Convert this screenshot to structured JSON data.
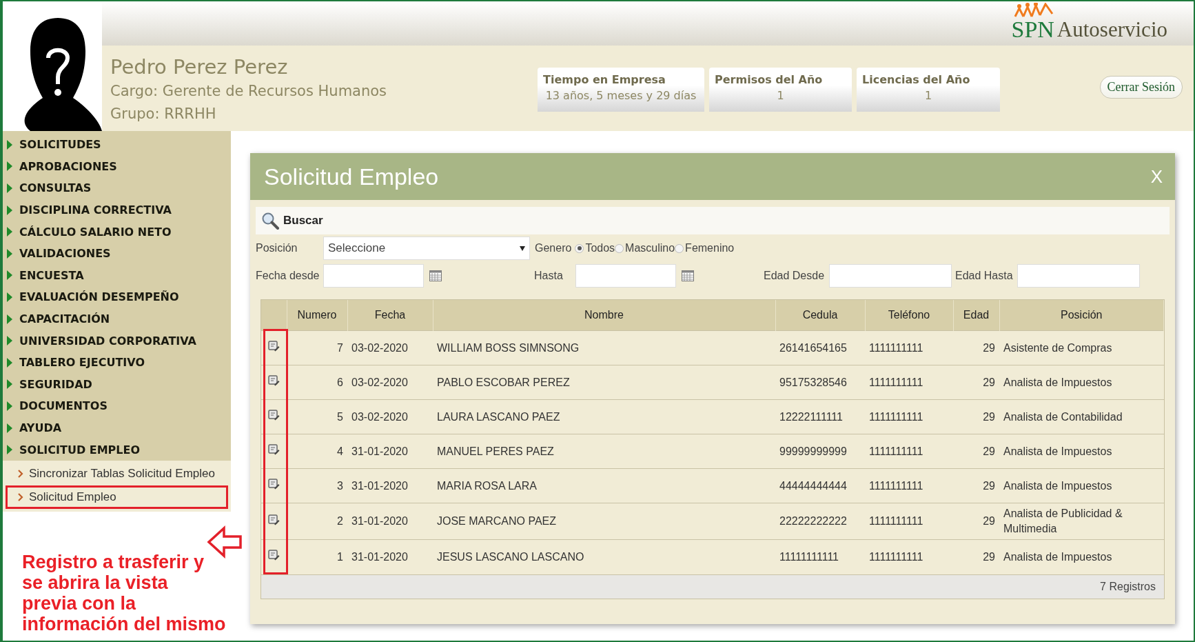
{
  "user": {
    "name": "Pedro Perez Perez",
    "cargo": "Cargo: Gerente de Recursos Humanos",
    "grupo": "Grupo: RRRHH"
  },
  "brand": {
    "short": "SPN",
    "name": "Autoservicio"
  },
  "stats": [
    {
      "title": "Tiempo en Empresa",
      "value": "13 años, 5 meses y 29 días"
    },
    {
      "title": "Permisos del Año",
      "value": "1"
    },
    {
      "title": "Licencias del Año",
      "value": "1"
    }
  ],
  "logout_button": "Cerrar Sesión",
  "sidebar": {
    "items": [
      {
        "label": "SOLICITUDES"
      },
      {
        "label": "APROBACIONES"
      },
      {
        "label": "CONSULTAS"
      },
      {
        "label": "DISCIPLINA CORRECTIVA"
      },
      {
        "label": "CÁLCULO SALARIO NETO"
      },
      {
        "label": "VALIDACIONES"
      },
      {
        "label": "ENCUESTA"
      },
      {
        "label": "EVALUACIÓN DESEMPEÑO"
      },
      {
        "label": "CAPACITACIÓN"
      },
      {
        "label": "UNIVERSIDAD CORPORATIVA"
      },
      {
        "label": "TABLERO EJECUTIVO"
      },
      {
        "label": "SEGURIDAD"
      },
      {
        "label": "DOCUMENTOS"
      },
      {
        "label": "AYUDA"
      },
      {
        "label": "SOLICITUD EMPLEO",
        "children": [
          {
            "label": "Sincronizar Tablas Solicitud Empleo",
            "selected": false
          },
          {
            "label": "Solicitud Empleo",
            "selected": true
          }
        ]
      }
    ]
  },
  "annotation": {
    "text": "Registro a trasferir y\nse abrira la vista\nprevia con la\ninformación del mismo"
  },
  "dialog": {
    "title": "Solicitud Empleo",
    "close": "X",
    "search_label": "Buscar",
    "filters": {
      "position": {
        "label": "Posición",
        "value": "Seleccione"
      },
      "gender": {
        "label": "Genero",
        "options": [
          {
            "label": "Todos",
            "selected": true
          },
          {
            "label": "Masculino",
            "selected": false
          },
          {
            "label": "Femenino",
            "selected": false
          }
        ]
      },
      "date_from": {
        "label": "Fecha desde"
      },
      "date_to": {
        "label": "Hasta"
      },
      "age_from": {
        "label": "Edad Desde"
      },
      "age_to": {
        "label": "Edad Hasta"
      }
    },
    "table": {
      "columns": [
        "Numero",
        "Fecha",
        "Nombre",
        "Cedula",
        "Teléfono",
        "Edad",
        "Posición"
      ],
      "rows": [
        {
          "cells": [
            "7",
            "03-02-2020",
            "WILLIAM BOSS SIMNSONG",
            "26141654165",
            "1111111111",
            "29",
            "Asistente de Compras"
          ]
        },
        {
          "cells": [
            "6",
            "03-02-2020",
            "PABLO ESCOBAR PEREZ",
            "95175328546",
            "1111111111",
            "29",
            "Analista de Impuestos"
          ]
        },
        {
          "cells": [
            "5",
            "03-02-2020",
            "LAURA LASCANO PAEZ",
            "12222111111",
            "1111111111",
            "29",
            "Analista de Contabilidad"
          ]
        },
        {
          "cells": [
            "4",
            "31-01-2020",
            "MANUEL PERES PAEZ",
            "99999999999",
            "1111111111",
            "29",
            "Analista de Impuestos"
          ]
        },
        {
          "cells": [
            "3",
            "31-01-2020",
            "MARIA ROSA LARA",
            "44444444444",
            "1111111111",
            "29",
            "Analista de Impuestos"
          ]
        },
        {
          "cells": [
            "2",
            "31-01-2020",
            "JOSE MARCANO PAEZ",
            "22222222222",
            "1111111111",
            "29",
            "Analista de Publicidad & Multimedia"
          ]
        },
        {
          "cells": [
            "1",
            "31-01-2020",
            "JESUS LASCANO LASCANO",
            "11111111111",
            "1111111111",
            "29",
            "Analista de Impuestos"
          ]
        }
      ]
    },
    "footer": "7 Registros"
  }
}
